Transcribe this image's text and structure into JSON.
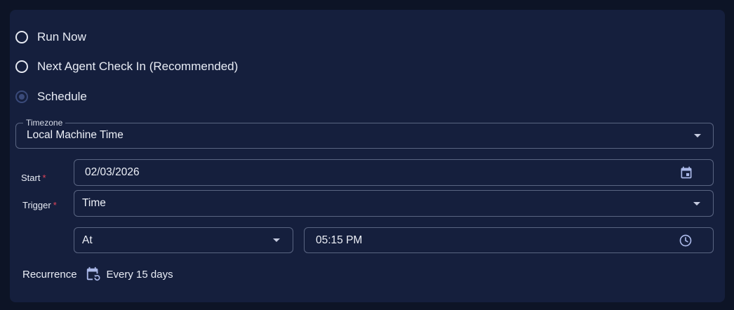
{
  "options": [
    {
      "label": "Run Now",
      "checked": false
    },
    {
      "label": "Next Agent Check In (Recommended)",
      "checked": false
    },
    {
      "label": "Schedule",
      "checked": true
    }
  ],
  "timezone": {
    "legend": "Timezone",
    "value": "Local Machine Time"
  },
  "start": {
    "label": "Start",
    "required": "*",
    "value": "02/03/2026",
    "icon": "calendar-icon"
  },
  "trigger": {
    "label": "Trigger",
    "required": "*",
    "value": "Time"
  },
  "at": {
    "value": "At"
  },
  "time": {
    "value": "05:15 PM",
    "icon": "clock-icon"
  },
  "recurrence": {
    "label": "Recurrence",
    "value": "Every 15 days",
    "icon": "calendar-repeat-icon"
  },
  "colors": {
    "background": "#0d1426",
    "panel": "#151f3d",
    "border": "#5a6582",
    "required": "#e0455a",
    "icon": "#aab8e8"
  }
}
